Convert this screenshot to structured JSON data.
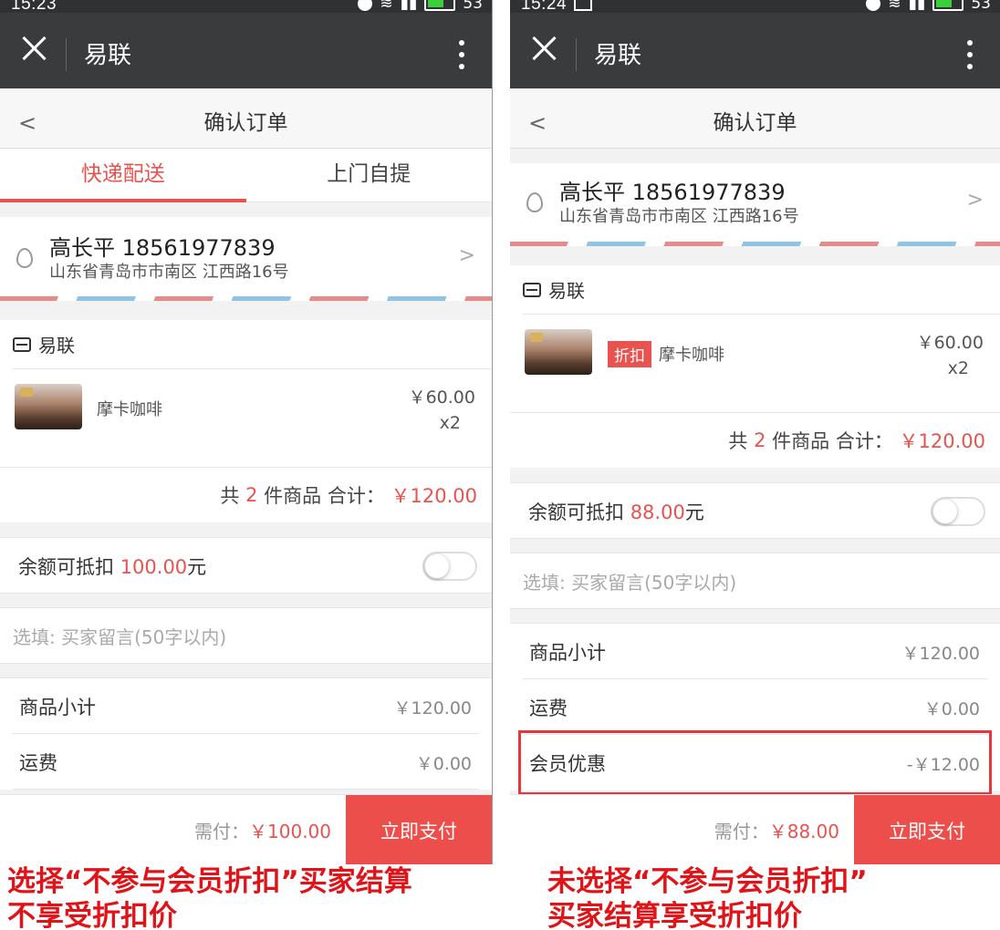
{
  "left": {
    "status": {
      "time": "15:23",
      "battery": "53"
    },
    "app": {
      "title": "易联"
    },
    "nav": {
      "title": "确认订单"
    },
    "tabs": [
      {
        "label": "快递配送",
        "active": true
      },
      {
        "label": "上门自提",
        "active": false
      }
    ],
    "address": {
      "name_phone": "高长平 18561977839",
      "line": "山东省青岛市市南区 江西路16号"
    },
    "shop": {
      "name": "易联"
    },
    "item": {
      "name": "摩卡咖啡",
      "price": "￥60.00",
      "qty": "x2"
    },
    "total": {
      "prefix": "共",
      "count": "2",
      "mid": "件商品 合计：",
      "amount": "￥120.00"
    },
    "balance": {
      "prefix": "余额可抵扣",
      "amount": "100.00",
      "suffix": "元",
      "enabled": false
    },
    "note": {
      "placeholder": "选填: 买家留言(50字以内)"
    },
    "summary": [
      {
        "label": "商品小计",
        "value": "￥120.00"
      },
      {
        "label": "运费",
        "value": "￥0.00"
      }
    ],
    "pay": {
      "due_label": "需付：",
      "due_amount": "￥100.00",
      "button": "立即支付"
    },
    "caption": [
      "选择“不参与会员折扣”买家结算",
      "不享受折扣价"
    ]
  },
  "right": {
    "status": {
      "time": "15:24",
      "battery": "53"
    },
    "app": {
      "title": "易联"
    },
    "nav": {
      "title": "确认订单"
    },
    "address": {
      "name_phone": "高长平 18561977839",
      "line": "山东省青岛市市南区 江西路16号"
    },
    "shop": {
      "name": "易联"
    },
    "item": {
      "badge": "折扣",
      "name": "摩卡咖啡",
      "price": "￥60.00",
      "qty": "x2"
    },
    "total": {
      "prefix": "共",
      "count": "2",
      "mid": "件商品 合计：",
      "amount": "￥120.00"
    },
    "balance": {
      "prefix": "余额可抵扣",
      "amount": "88.00",
      "suffix": "元",
      "enabled": false
    },
    "note": {
      "placeholder": "选填: 买家留言(50字以内)"
    },
    "summary": [
      {
        "label": "商品小计",
        "value": "￥120.00"
      },
      {
        "label": "运费",
        "value": "￥0.00"
      },
      {
        "label": "会员优惠",
        "value": "-￥12.00"
      }
    ],
    "pay": {
      "due_label": "需付：",
      "due_amount": "￥88.00",
      "button": "立即支付"
    },
    "caption": [
      "未选择“不参与会员折扣”",
      "买家结算享受折扣价"
    ]
  },
  "colors": {
    "accent": "#e8534f",
    "caption": "#e01418",
    "appbar": "#3a3b3c"
  }
}
